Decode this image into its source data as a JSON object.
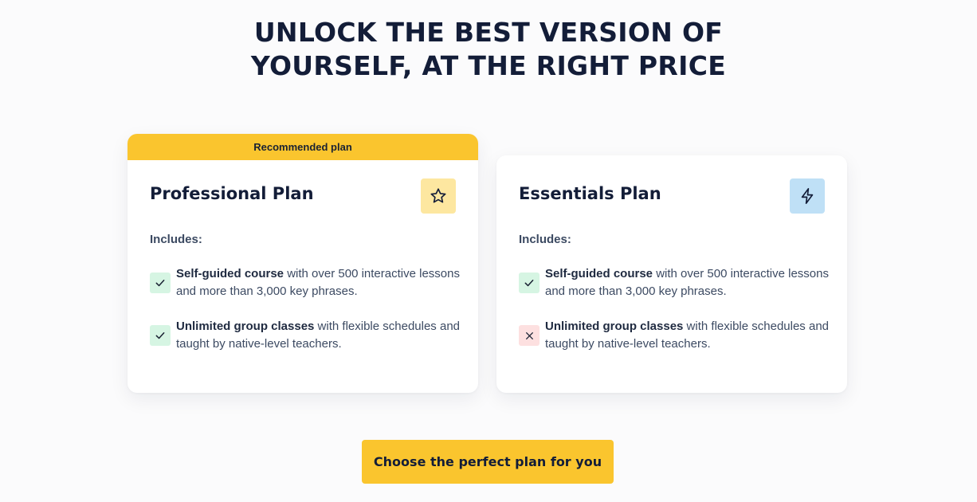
{
  "headline": {
    "line1": "UNLOCK THE BEST VERSION OF",
    "line2": "YOURSELF, AT THE RIGHT PRICE"
  },
  "plans": [
    {
      "ribbon": "Recommended plan",
      "title": "Professional Plan",
      "icon": "star-icon",
      "icon_bg": "#fde7a0",
      "includes_label": "Includes:",
      "features": [
        {
          "bold": "Self-guided course",
          "rest": " with over 500 interactive lessons and more than 3,000 key phrases.",
          "included": true
        },
        {
          "bold": "Unlimited group classes",
          "rest": " with flexible schedules and taught by native-level teachers.",
          "included": true
        }
      ]
    },
    {
      "title": "Essentials Plan",
      "icon": "lightning-icon",
      "icon_bg": "#bfe0f6",
      "includes_label": "Includes:",
      "features": [
        {
          "bold": "Self-guided course",
          "rest": " with over 500 interactive lessons and more than 3,000 key phrases.",
          "included": true
        },
        {
          "bold": "Unlimited group classes",
          "rest": " with flexible schedules and taught by native-level teachers.",
          "included": false
        }
      ]
    }
  ],
  "cta": {
    "label": "Choose the perfect plan for you"
  },
  "colors": {
    "accent": "#fac52e",
    "check_bg": "#d6f5e3",
    "cross_bg": "#fde0e0",
    "text_dark": "#131d38"
  }
}
